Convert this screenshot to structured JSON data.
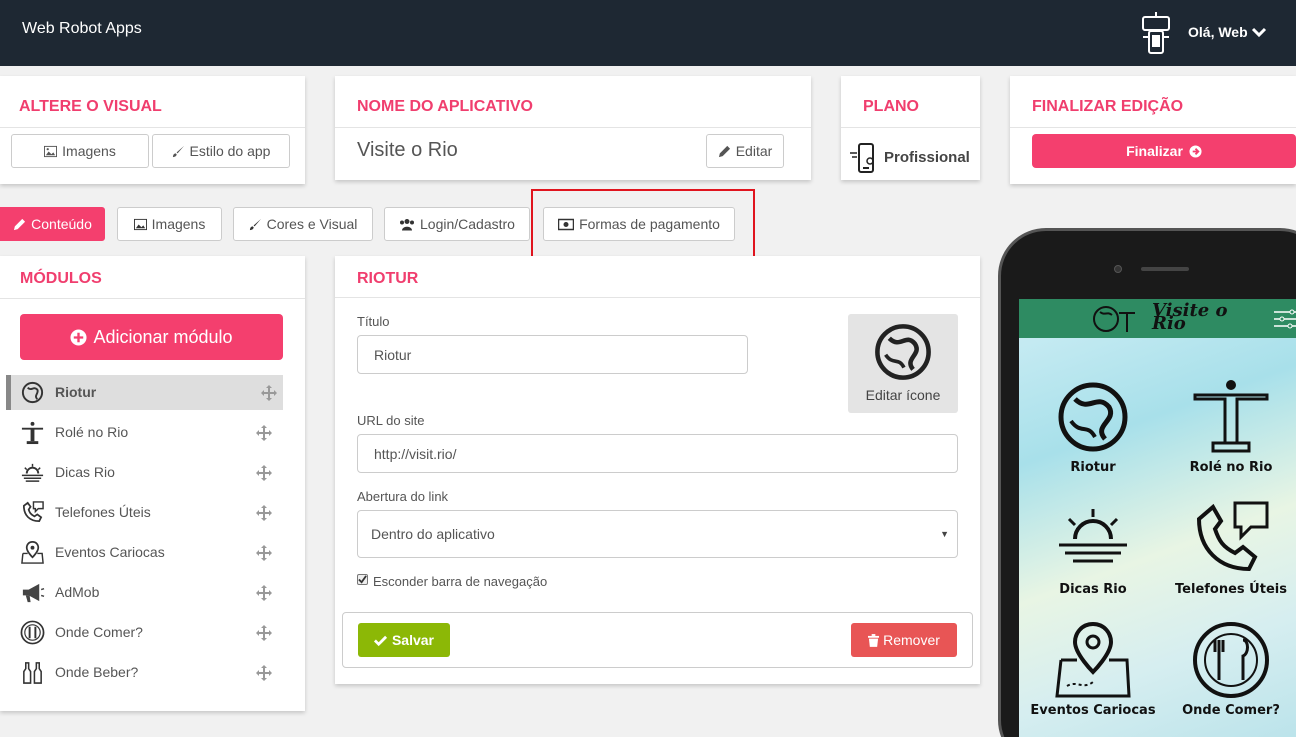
{
  "topbar": {
    "brand": "Web Robot Apps",
    "greeting": "Olá, Web"
  },
  "cards": {
    "visual": {
      "title": "ALTERE O VISUAL",
      "images_btn": "Imagens",
      "style_btn": "Estilo do app"
    },
    "appname": {
      "title": "NOME DO APLICATIVO",
      "value": "Visite o Rio",
      "edit_btn": "Editar"
    },
    "plan": {
      "title": "PLANO",
      "value": "Profissional"
    },
    "finish": {
      "title": "FINALIZAR EDIÇÃO",
      "btn": "Finalizar"
    }
  },
  "tabs": [
    {
      "label": "Conteúdo"
    },
    {
      "label": "Imagens"
    },
    {
      "label": "Cores e Visual"
    },
    {
      "label": "Login/Cadastro"
    },
    {
      "label": "Formas de pagamento"
    }
  ],
  "modules": {
    "title": "MÓDULOS",
    "add_btn": "Adicionar módulo",
    "items": [
      {
        "label": "Riotur",
        "icon": "riotur-icon"
      },
      {
        "label": "Rolé no Rio",
        "icon": "christ-statue-icon"
      },
      {
        "label": "Dicas Rio",
        "icon": "sunset-icon"
      },
      {
        "label": "Telefones Úteis",
        "icon": "phone-chat-icon"
      },
      {
        "label": "Eventos Cariocas",
        "icon": "map-pin-icon"
      },
      {
        "label": "AdMob",
        "icon": "megaphone-icon"
      },
      {
        "label": "Onde Comer?",
        "icon": "plate-cutlery-icon"
      },
      {
        "label": "Onde Beber?",
        "icon": "beer-bottles-icon"
      }
    ]
  },
  "editor": {
    "title": "RIOTUR",
    "title_label": "Título",
    "title_value": "Riotur",
    "url_label": "URL do site",
    "url_value": "http://visit.rio/",
    "open_label": "Abertura do link",
    "open_value": "Dentro do aplicativo",
    "hide_nav_label": "Esconder barra de navegação",
    "hide_nav_checked": true,
    "edit_icon_label": "Editar ícone",
    "save_btn": "Salvar",
    "remove_btn": "Remover"
  },
  "phone": {
    "title": "Visite o Rio",
    "grid": [
      {
        "label": "Riotur"
      },
      {
        "label": "Rolé no Rio"
      },
      {
        "label": "Dicas Rio"
      },
      {
        "label": "Telefones Úteis"
      },
      {
        "label": "Eventos Cariocas"
      },
      {
        "label": "Onde Comer?"
      }
    ]
  },
  "colors": {
    "accent": "#f43f6e",
    "header": "#1e2833",
    "success": "#8cb806",
    "danger": "#e85555",
    "phone_header": "#2e8b62"
  }
}
